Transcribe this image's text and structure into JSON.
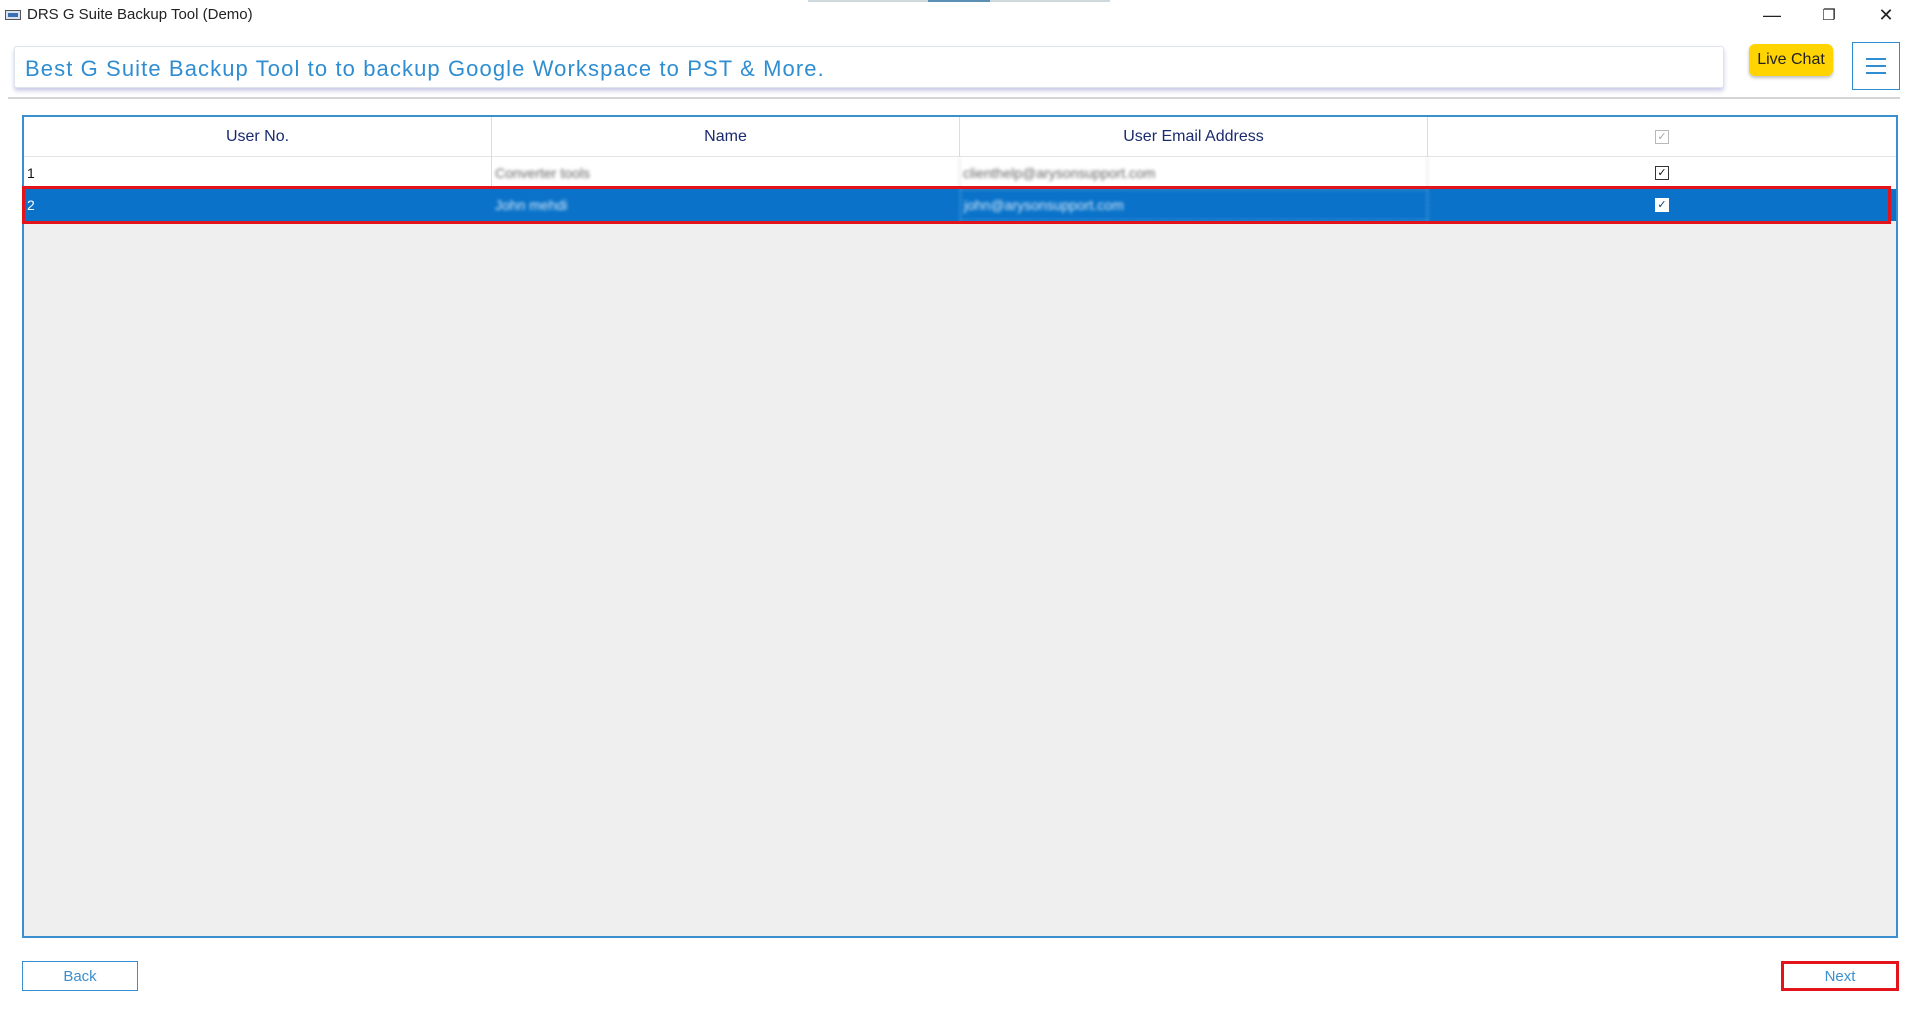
{
  "window": {
    "title": "DRS G Suite Backup Tool (Demo)",
    "icons": {
      "app": "app-icon",
      "minimize": "minimize-icon",
      "restore": "restore-icon",
      "close": "close-icon"
    },
    "minimize_glyph": "—",
    "restore_glyph": "❐",
    "close_glyph": "✕"
  },
  "header": {
    "banner": "Best G Suite Backup Tool to to backup Google Workspace to PST & More.",
    "live_chat": "Live Chat",
    "menu_icon": "hamburger-menu-icon"
  },
  "table": {
    "columns": [
      "User No.",
      "Name",
      "User Email Address"
    ],
    "select_all_checked": true,
    "rows": [
      {
        "no": "1",
        "name": "Converter tools",
        "email": "clienthelp@arysonsupport.com",
        "checked": true,
        "selected": false
      },
      {
        "no": "2",
        "name": "John mehdi",
        "email": "john@arysonsupport.com",
        "checked": true,
        "selected": true
      }
    ]
  },
  "footer": {
    "back": "Back",
    "next": "Next"
  },
  "colors": {
    "accent": "#2f8dd1",
    "selected_row": "#0a73c9",
    "live_chat_bg": "#ffd400",
    "highlight": "#e3131b"
  }
}
